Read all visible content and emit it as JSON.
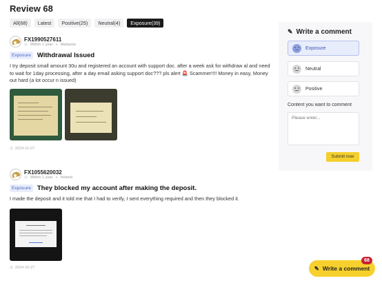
{
  "page": {
    "title": "Review 68"
  },
  "filters": [
    {
      "label": "All(68)",
      "active": false
    },
    {
      "label": "Latest",
      "active": false
    },
    {
      "label": "Positive(25)",
      "active": false
    },
    {
      "label": "Neutral(4)",
      "active": false
    },
    {
      "label": "Exposure(39)",
      "active": true
    }
  ],
  "reviews": [
    {
      "user": "FX1990527611",
      "period": "Within 1 year",
      "location": "Malaysia",
      "tag": "Exposure",
      "title": "Withdrawal Issued",
      "body": "I try deposit small amount 30u and registered an account with support doc. after a week ask for withdraw al and need to wait for 1day processing, after a day email asking support doc??? pls alert 🚨 Scammer!!!! Money in easy, Money out hard (a lot occur n issued)",
      "date": "2024-11-07"
    },
    {
      "user": "FX1055620032",
      "period": "Within 1 year",
      "location": "Ireland",
      "tag": "Exposure",
      "title": "They blocked my account after making the deposit.",
      "body": "I made the deposit and it told me that I had to verify, I sent everything required and then they blocked it.",
      "date": "2024-10-27"
    }
  ],
  "panel": {
    "title": "Write a comment",
    "options": [
      {
        "label": "Exposure",
        "active": true
      },
      {
        "label": "Neutral",
        "active": false
      },
      {
        "label": "Positive",
        "active": false
      }
    ],
    "content_label": "Content you want to comment",
    "placeholder": "Please enter...",
    "submit_label": "Submit now"
  },
  "fab": {
    "label": "Write a comment",
    "badge": "68"
  }
}
